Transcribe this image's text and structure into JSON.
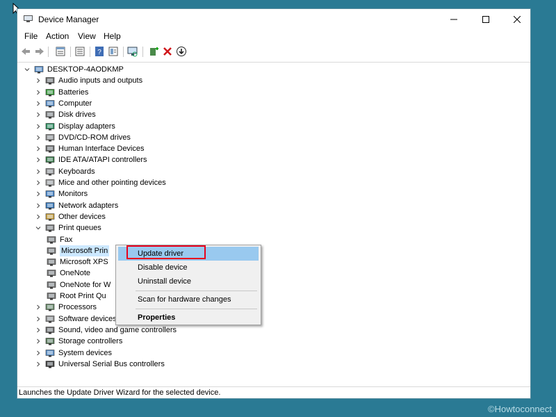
{
  "window": {
    "title": "Device Manager"
  },
  "menubar": [
    "File",
    "Action",
    "View",
    "Help"
  ],
  "toolbar": [
    "back-icon",
    "forward-icon",
    "properties-icon",
    "show-hide-tree-icon",
    "help-icon",
    "view-icon",
    "scan-hardware-icon",
    "add-driver-icon",
    "uninstall-icon",
    "update-icon"
  ],
  "tree": {
    "root": "DESKTOP-4AODKMP",
    "categories": [
      {
        "label": "Audio inputs and outputs",
        "icon": "audio-icon"
      },
      {
        "label": "Batteries",
        "icon": "battery-icon"
      },
      {
        "label": "Computer",
        "icon": "computer-icon"
      },
      {
        "label": "Disk drives",
        "icon": "disk-icon"
      },
      {
        "label": "Display adapters",
        "icon": "display-icon"
      },
      {
        "label": "DVD/CD-ROM drives",
        "icon": "dvd-icon"
      },
      {
        "label": "Human Interface Devices",
        "icon": "hid-icon"
      },
      {
        "label": "IDE ATA/ATAPI controllers",
        "icon": "ide-icon"
      },
      {
        "label": "Keyboards",
        "icon": "keyboard-icon"
      },
      {
        "label": "Mice and other pointing devices",
        "icon": "mouse-icon"
      },
      {
        "label": "Monitors",
        "icon": "monitor-icon"
      },
      {
        "label": "Network adapters",
        "icon": "network-icon"
      },
      {
        "label": "Other devices",
        "icon": "other-devices-icon"
      },
      {
        "label": "Print queues",
        "icon": "printer-icon",
        "expanded": true
      }
    ],
    "print_queue_children": [
      "Fax",
      "Microsoft Prin",
      "Microsoft XPS",
      "OneNote",
      "OneNote for W",
      "Root Print Qu"
    ],
    "categories_after": [
      {
        "label": "Processors",
        "icon": "processor-icon"
      },
      {
        "label": "Software devices",
        "icon": "software-icon"
      },
      {
        "label": "Sound, video and game controllers",
        "icon": "sound-icon"
      },
      {
        "label": "Storage controllers",
        "icon": "storage-icon"
      },
      {
        "label": "System devices",
        "icon": "system-icon"
      },
      {
        "label": "Universal Serial Bus controllers",
        "icon": "usb-icon"
      }
    ]
  },
  "context_menu": {
    "update": "Update driver",
    "disable": "Disable device",
    "uninstall": "Uninstall device",
    "scan": "Scan for hardware changes",
    "properties": "Properties"
  },
  "status": "Launches the Update Driver Wizard for the selected device.",
  "watermark": "©Howtoconnect",
  "colors": {
    "desktop": "#2a7a94",
    "highlight": "#99c9ef",
    "selection": "#cce8ff",
    "annotation": "#e8001c"
  }
}
